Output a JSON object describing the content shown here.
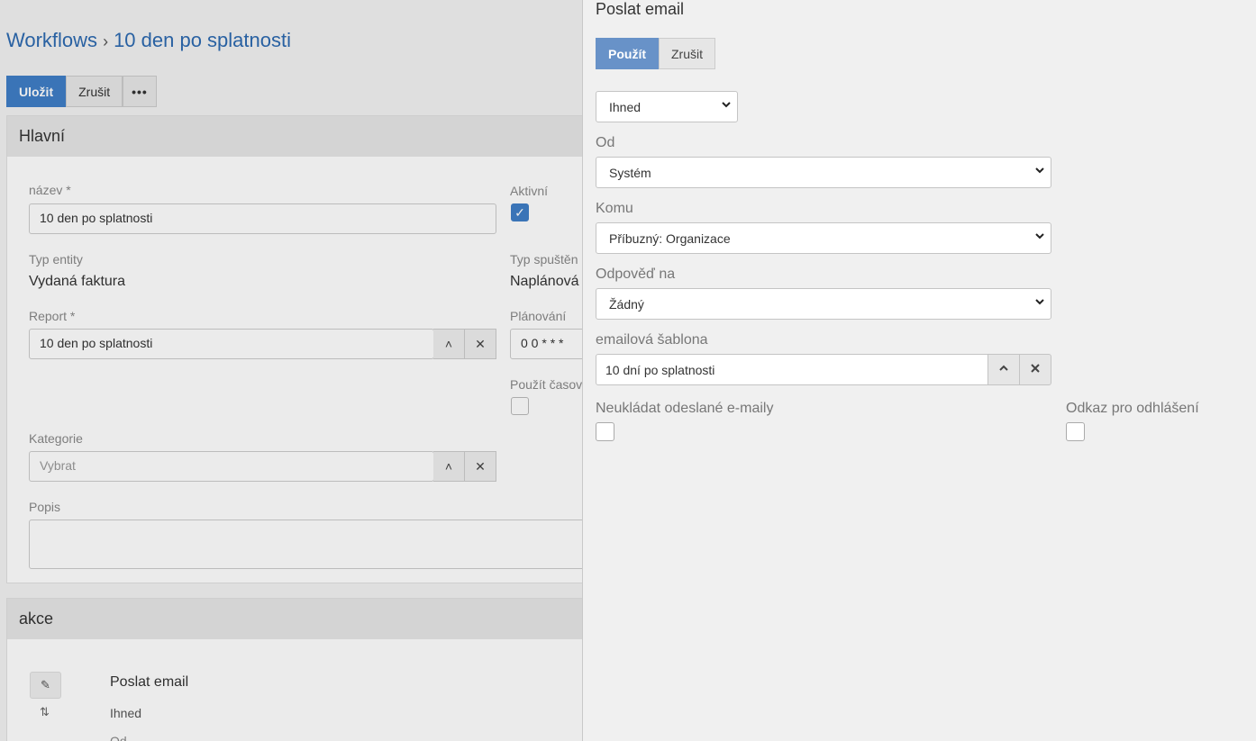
{
  "background": {
    "breadcrumb": {
      "root": "Workflows",
      "separator": "›",
      "current": "10 den po splatnosti"
    },
    "toolbar": {
      "save_label": "Uložit",
      "cancel_label": "Zrušit",
      "more_label": "•••"
    },
    "main_panel": {
      "title": "Hlavní",
      "name_label": "název *",
      "name_value": "10 den po splatnosti",
      "active_label": "Aktivní",
      "active_checked": true,
      "entity_type_label": "Typ entity",
      "entity_type_value": "Vydaná faktura",
      "trigger_type_label": "Typ spuštěn",
      "trigger_type_value": "Naplánová",
      "report_label": "Report *",
      "report_value": "10 den po splatnosti",
      "scheduling_label": "Plánování",
      "scheduling_value": "0 0 * * *",
      "use_time_label": "Použít časov",
      "category_label": "Kategorie",
      "category_placeholder": "Vybrat",
      "description_label": "Popis"
    },
    "actions_panel": {
      "title": "akce",
      "action_name": "Poslat email",
      "action_timing": "Ihned",
      "action_from_label": "Od"
    }
  },
  "modal": {
    "title": "Poslat email",
    "apply_label": "Použít",
    "cancel_label": "Zrušit",
    "timing_value": "Ihned",
    "from_label": "Od",
    "from_value": "Systém",
    "to_label": "Komu",
    "to_value": "Příbuzný: Organizace",
    "reply_to_label": "Odpověď na",
    "reply_to_value": "Žádný",
    "template_label": "emailová šablona",
    "template_value": "10 dní po splatnosti",
    "do_not_store_label": "Neukládat odeslané e-maily",
    "do_not_store_checked": false,
    "unsubscribe_link_label": "Odkaz pro odhlášení",
    "unsubscribe_link_checked": false
  }
}
